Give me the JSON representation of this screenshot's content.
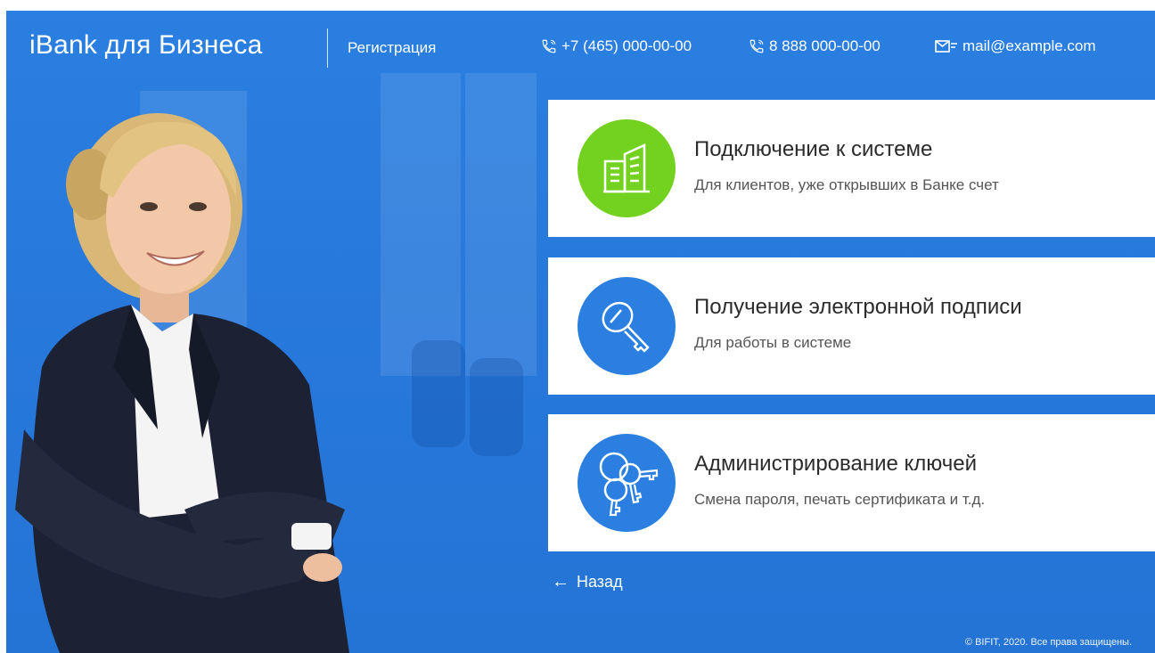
{
  "header": {
    "logo": "iBank для Бизнеса",
    "registration_link": "Регистрация",
    "phone1": "+7 (465) 000-00-00",
    "phone2": "8 888 000-00-00",
    "email": "mail@example.com"
  },
  "cards": [
    {
      "title": "Подключение к системе",
      "subtitle": "Для клиентов, уже открывших в Банке счет",
      "icon": "building-icon",
      "color": "#72d21f"
    },
    {
      "title": "Получение электронной подписи",
      "subtitle": "Для работы в системе",
      "icon": "key-icon",
      "color": "#2a7fe0"
    },
    {
      "title": "Администрирование ключей",
      "subtitle": "Смена пароля, печать сертификата и т.д.",
      "icon": "keys-bunch-icon",
      "color": "#2a7fe0"
    }
  ],
  "back_link": "Назад",
  "footer": "© BIFIT, 2020. Все права защищены.",
  "colors": {
    "background": "#2a7fe0",
    "accent_green": "#72d21f",
    "accent_blue": "#2a7fe0"
  }
}
